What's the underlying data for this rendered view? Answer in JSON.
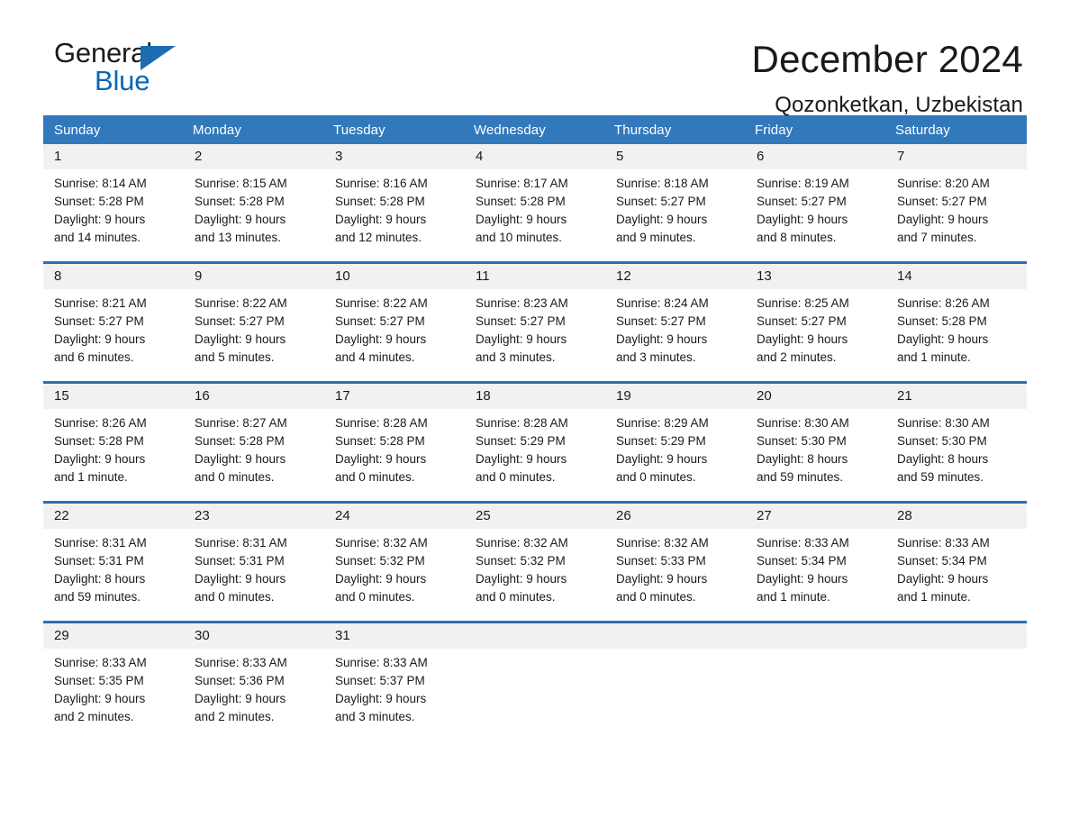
{
  "brand": {
    "name_part1": "General",
    "name_part2": "Blue",
    "accent_color": "#1b6cb0",
    "header_color": "#3279bb"
  },
  "header": {
    "title": "December 2024",
    "subtitle": "Qozonketkan, Uzbekistan"
  },
  "weekdays": [
    "Sunday",
    "Monday",
    "Tuesday",
    "Wednesday",
    "Thursday",
    "Friday",
    "Saturday"
  ],
  "weeks": [
    {
      "days": [
        {
          "num": "1",
          "sunrise": "Sunrise: 8:14 AM",
          "sunset": "Sunset: 5:28 PM",
          "daylight1": "Daylight: 9 hours",
          "daylight2": "and 14 minutes."
        },
        {
          "num": "2",
          "sunrise": "Sunrise: 8:15 AM",
          "sunset": "Sunset: 5:28 PM",
          "daylight1": "Daylight: 9 hours",
          "daylight2": "and 13 minutes."
        },
        {
          "num": "3",
          "sunrise": "Sunrise: 8:16 AM",
          "sunset": "Sunset: 5:28 PM",
          "daylight1": "Daylight: 9 hours",
          "daylight2": "and 12 minutes."
        },
        {
          "num": "4",
          "sunrise": "Sunrise: 8:17 AM",
          "sunset": "Sunset: 5:28 PM",
          "daylight1": "Daylight: 9 hours",
          "daylight2": "and 10 minutes."
        },
        {
          "num": "5",
          "sunrise": "Sunrise: 8:18 AM",
          "sunset": "Sunset: 5:27 PM",
          "daylight1": "Daylight: 9 hours",
          "daylight2": "and 9 minutes."
        },
        {
          "num": "6",
          "sunrise": "Sunrise: 8:19 AM",
          "sunset": "Sunset: 5:27 PM",
          "daylight1": "Daylight: 9 hours",
          "daylight2": "and 8 minutes."
        },
        {
          "num": "7",
          "sunrise": "Sunrise: 8:20 AM",
          "sunset": "Sunset: 5:27 PM",
          "daylight1": "Daylight: 9 hours",
          "daylight2": "and 7 minutes."
        }
      ]
    },
    {
      "days": [
        {
          "num": "8",
          "sunrise": "Sunrise: 8:21 AM",
          "sunset": "Sunset: 5:27 PM",
          "daylight1": "Daylight: 9 hours",
          "daylight2": "and 6 minutes."
        },
        {
          "num": "9",
          "sunrise": "Sunrise: 8:22 AM",
          "sunset": "Sunset: 5:27 PM",
          "daylight1": "Daylight: 9 hours",
          "daylight2": "and 5 minutes."
        },
        {
          "num": "10",
          "sunrise": "Sunrise: 8:22 AM",
          "sunset": "Sunset: 5:27 PM",
          "daylight1": "Daylight: 9 hours",
          "daylight2": "and 4 minutes."
        },
        {
          "num": "11",
          "sunrise": "Sunrise: 8:23 AM",
          "sunset": "Sunset: 5:27 PM",
          "daylight1": "Daylight: 9 hours",
          "daylight2": "and 3 minutes."
        },
        {
          "num": "12",
          "sunrise": "Sunrise: 8:24 AM",
          "sunset": "Sunset: 5:27 PM",
          "daylight1": "Daylight: 9 hours",
          "daylight2": "and 3 minutes."
        },
        {
          "num": "13",
          "sunrise": "Sunrise: 8:25 AM",
          "sunset": "Sunset: 5:27 PM",
          "daylight1": "Daylight: 9 hours",
          "daylight2": "and 2 minutes."
        },
        {
          "num": "14",
          "sunrise": "Sunrise: 8:26 AM",
          "sunset": "Sunset: 5:28 PM",
          "daylight1": "Daylight: 9 hours",
          "daylight2": "and 1 minute."
        }
      ]
    },
    {
      "days": [
        {
          "num": "15",
          "sunrise": "Sunrise: 8:26 AM",
          "sunset": "Sunset: 5:28 PM",
          "daylight1": "Daylight: 9 hours",
          "daylight2": "and 1 minute."
        },
        {
          "num": "16",
          "sunrise": "Sunrise: 8:27 AM",
          "sunset": "Sunset: 5:28 PM",
          "daylight1": "Daylight: 9 hours",
          "daylight2": "and 0 minutes."
        },
        {
          "num": "17",
          "sunrise": "Sunrise: 8:28 AM",
          "sunset": "Sunset: 5:28 PM",
          "daylight1": "Daylight: 9 hours",
          "daylight2": "and 0 minutes."
        },
        {
          "num": "18",
          "sunrise": "Sunrise: 8:28 AM",
          "sunset": "Sunset: 5:29 PM",
          "daylight1": "Daylight: 9 hours",
          "daylight2": "and 0 minutes."
        },
        {
          "num": "19",
          "sunrise": "Sunrise: 8:29 AM",
          "sunset": "Sunset: 5:29 PM",
          "daylight1": "Daylight: 9 hours",
          "daylight2": "and 0 minutes."
        },
        {
          "num": "20",
          "sunrise": "Sunrise: 8:30 AM",
          "sunset": "Sunset: 5:30 PM",
          "daylight1": "Daylight: 8 hours",
          "daylight2": "and 59 minutes."
        },
        {
          "num": "21",
          "sunrise": "Sunrise: 8:30 AM",
          "sunset": "Sunset: 5:30 PM",
          "daylight1": "Daylight: 8 hours",
          "daylight2": "and 59 minutes."
        }
      ]
    },
    {
      "days": [
        {
          "num": "22",
          "sunrise": "Sunrise: 8:31 AM",
          "sunset": "Sunset: 5:31 PM",
          "daylight1": "Daylight: 8 hours",
          "daylight2": "and 59 minutes."
        },
        {
          "num": "23",
          "sunrise": "Sunrise: 8:31 AM",
          "sunset": "Sunset: 5:31 PM",
          "daylight1": "Daylight: 9 hours",
          "daylight2": "and 0 minutes."
        },
        {
          "num": "24",
          "sunrise": "Sunrise: 8:32 AM",
          "sunset": "Sunset: 5:32 PM",
          "daylight1": "Daylight: 9 hours",
          "daylight2": "and 0 minutes."
        },
        {
          "num": "25",
          "sunrise": "Sunrise: 8:32 AM",
          "sunset": "Sunset: 5:32 PM",
          "daylight1": "Daylight: 9 hours",
          "daylight2": "and 0 minutes."
        },
        {
          "num": "26",
          "sunrise": "Sunrise: 8:32 AM",
          "sunset": "Sunset: 5:33 PM",
          "daylight1": "Daylight: 9 hours",
          "daylight2": "and 0 minutes."
        },
        {
          "num": "27",
          "sunrise": "Sunrise: 8:33 AM",
          "sunset": "Sunset: 5:34 PM",
          "daylight1": "Daylight: 9 hours",
          "daylight2": "and 1 minute."
        },
        {
          "num": "28",
          "sunrise": "Sunrise: 8:33 AM",
          "sunset": "Sunset: 5:34 PM",
          "daylight1": "Daylight: 9 hours",
          "daylight2": "and 1 minute."
        }
      ]
    },
    {
      "days": [
        {
          "num": "29",
          "sunrise": "Sunrise: 8:33 AM",
          "sunset": "Sunset: 5:35 PM",
          "daylight1": "Daylight: 9 hours",
          "daylight2": "and 2 minutes."
        },
        {
          "num": "30",
          "sunrise": "Sunrise: 8:33 AM",
          "sunset": "Sunset: 5:36 PM",
          "daylight1": "Daylight: 9 hours",
          "daylight2": "and 2 minutes."
        },
        {
          "num": "31",
          "sunrise": "Sunrise: 8:33 AM",
          "sunset": "Sunset: 5:37 PM",
          "daylight1": "Daylight: 9 hours",
          "daylight2": "and 3 minutes."
        },
        {
          "num": "",
          "sunrise": "",
          "sunset": "",
          "daylight1": "",
          "daylight2": ""
        },
        {
          "num": "",
          "sunrise": "",
          "sunset": "",
          "daylight1": "",
          "daylight2": ""
        },
        {
          "num": "",
          "sunrise": "",
          "sunset": "",
          "daylight1": "",
          "daylight2": ""
        },
        {
          "num": "",
          "sunrise": "",
          "sunset": "",
          "daylight1": "",
          "daylight2": ""
        }
      ]
    }
  ]
}
